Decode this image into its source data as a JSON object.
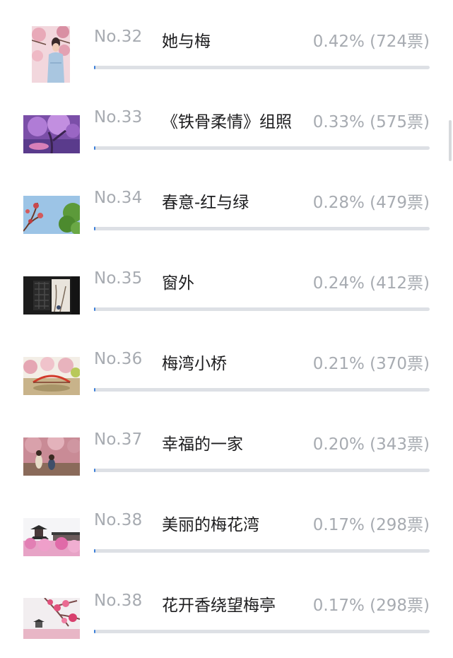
{
  "entries": [
    {
      "rank": "No.32",
      "title": "她与梅",
      "stats": "0.42% (724票)",
      "share": 0.42,
      "icon": "photo-woman-plum-blossom"
    },
    {
      "rank": "No.33",
      "title": "《铁骨柔情》组照",
      "stats": "0.33% (575票)",
      "share": 0.33,
      "icon": "photo-purple-plum-tree"
    },
    {
      "rank": "No.34",
      "title": "春意-红与绿",
      "stats": "0.28% (479票)",
      "share": 0.28,
      "icon": "photo-red-green-branches"
    },
    {
      "rank": "No.35",
      "title": "窗外",
      "stats": "0.24% (412票)",
      "share": 0.24,
      "icon": "photo-window-view"
    },
    {
      "rank": "No.36",
      "title": "梅湾小桥",
      "stats": "0.21% (370票)",
      "share": 0.21,
      "icon": "photo-small-bridge"
    },
    {
      "rank": "No.37",
      "title": "幸福的一家",
      "stats": "0.20% (343票)",
      "share": 0.2,
      "icon": "photo-happy-family"
    },
    {
      "rank": "No.38",
      "title": "美丽的梅花湾",
      "stats": "0.17% (298票)",
      "share": 0.17,
      "icon": "photo-pagoda-plum-garden"
    },
    {
      "rank": "No.38",
      "title": "花开香绕望梅亭",
      "stats": "0.17% (298票)",
      "share": 0.17,
      "icon": "photo-pavilion-plum-branch"
    }
  ],
  "colors": {
    "bar_fill": "#3b7fd9",
    "bar_track": "#dde0e5",
    "muted_text": "#a7abb1",
    "title_text": "#1d1d1f"
  }
}
